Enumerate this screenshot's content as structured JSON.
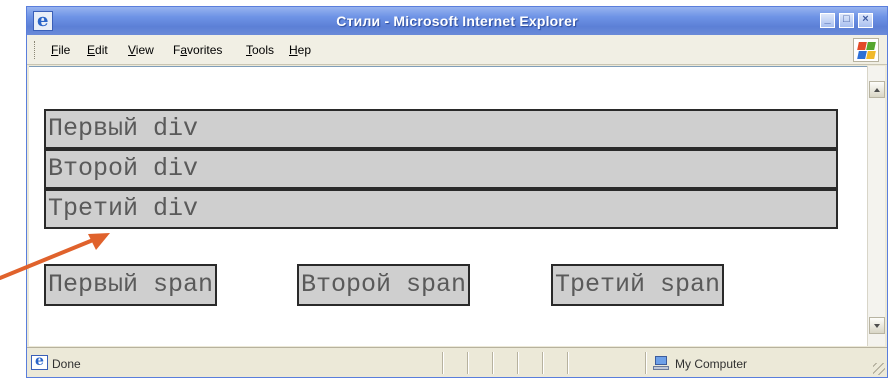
{
  "window": {
    "title": "Стили - Microsoft Internet Explorer"
  },
  "menu": {
    "items": [
      {
        "label": "File",
        "accel": "F"
      },
      {
        "label": "Edit",
        "accel": "E"
      },
      {
        "label": "View",
        "accel": "V"
      },
      {
        "label": "Favorites",
        "accel": "a"
      },
      {
        "label": "Tools",
        "accel": "T"
      },
      {
        "label": "Hep",
        "accel": "H"
      }
    ]
  },
  "content": {
    "divs": [
      "Первый div",
      "Второй div",
      "Третий div"
    ],
    "spans": [
      "Первый span",
      "Второй span",
      "Третий span"
    ]
  },
  "status": {
    "left_text": "Done",
    "zone_text": "My Computer"
  },
  "colors": {
    "block_fill": "#cfcfcf",
    "block_border": "#2a2a2a",
    "arrow": "#e0622c",
    "titlebar": "#6e93e6"
  },
  "icons": {
    "window": "ie-logo-icon",
    "throbber": "windows-flag-icon",
    "status": "ie-page-icon",
    "zone": "my-computer-icon",
    "annotation": "arrow-icon"
  }
}
